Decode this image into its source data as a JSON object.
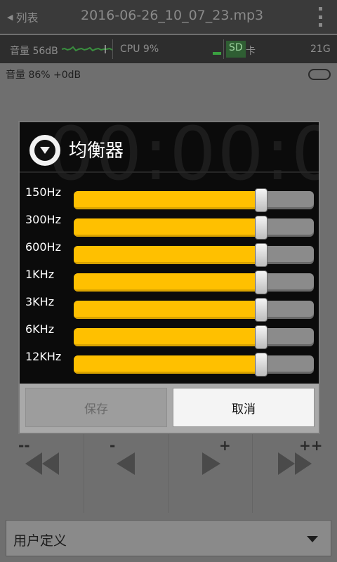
{
  "titlebar": {
    "back_label": "列表",
    "file_name": "2016-06-26_10_07_23.mp3"
  },
  "statusbar": {
    "volume_db": "音量 56dB",
    "cpu": "CPU 9%",
    "sd": "SD",
    "sd_suffix": "卡",
    "storage": "21G"
  },
  "volume_info": "音量 86% +0dB",
  "equalizer_dialog": {
    "title": "均衡器",
    "background_time": "00:00:08",
    "bands": [
      {
        "label": "150Hz",
        "level": 0.78
      },
      {
        "label": "300Hz",
        "level": 0.78
      },
      {
        "label": "600Hz",
        "level": 0.78
      },
      {
        "label": "1KHz",
        "level": 0.78
      },
      {
        "label": "3KHz",
        "level": 0.78
      },
      {
        "label": "6KHz",
        "level": 0.78
      },
      {
        "label": "12KHz",
        "level": 0.78
      }
    ],
    "save_label": "保存",
    "cancel_label": "取消"
  },
  "transport": {
    "marks": [
      "--",
      "-",
      "+",
      "++"
    ]
  },
  "preset": {
    "value": "用户定义"
  },
  "colors": {
    "accent": "#ffc000",
    "background": "#6f6f6f",
    "dialog": "#0b0b0b"
  },
  "icons": {
    "back": "back-arrow-icon",
    "menu": "overflow-menu-icon",
    "eq": "equalizer-collapse-icon"
  }
}
